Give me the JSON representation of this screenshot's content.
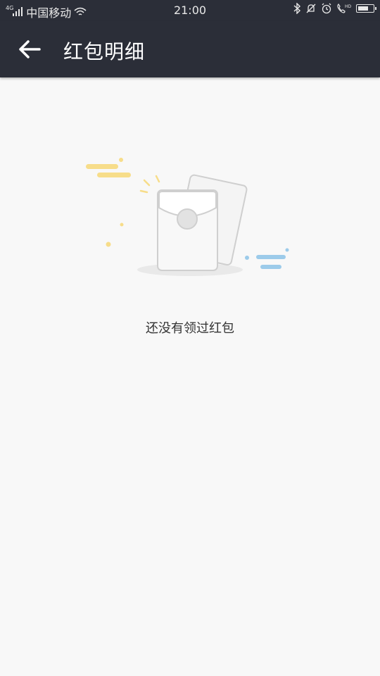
{
  "status_bar": {
    "network_type": "4G",
    "carrier": "中国移动",
    "time": "21:00",
    "battery_level": 0.6,
    "icons": [
      "signal-icon",
      "wifi-icon",
      "bluetooth-icon",
      "mute-icon",
      "alarm-icon",
      "hd-call-icon",
      "battery-icon"
    ]
  },
  "app_bar": {
    "back_icon": "arrow-left-icon",
    "title": "红包明细"
  },
  "empty_state": {
    "illustration": "red-envelope-icon",
    "message": "还没有领过红包"
  },
  "colors": {
    "bar_background": "#2b2e38",
    "page_background": "#f8f8f8",
    "accent_yellow": "#f7dd8a",
    "accent_blue": "#9ccbea"
  }
}
